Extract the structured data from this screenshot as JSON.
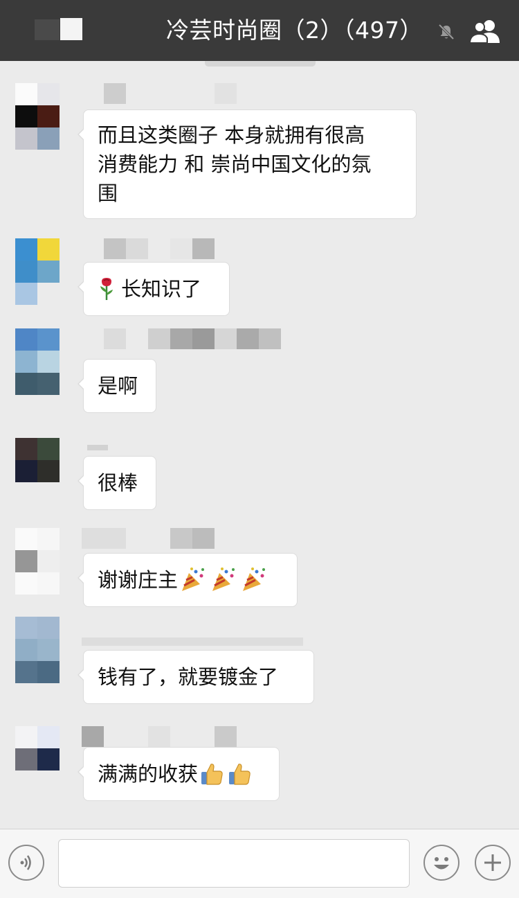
{
  "header": {
    "title": "冷芸时尚圈（2）（497）",
    "mute_icon": "bell-muted-icon",
    "members_icon": "group-members-icon"
  },
  "messages": [
    {
      "text": "而且这类圈子 本身就拥有很高\n消费能力 和 崇尚中国文化的氛\n围"
    },
    {
      "prefix_emoji": "rose",
      "text": "长知识了"
    },
    {
      "text": "是啊"
    },
    {
      "text": "很棒"
    },
    {
      "text": "谢谢庄主",
      "suffix_emoji": [
        "party-popper",
        "party-popper",
        "party-popper"
      ]
    },
    {
      "text": "钱有了，就要镀金了"
    },
    {
      "text": "满满的收获",
      "suffix_emoji": [
        "thumbs-up",
        "thumbs-up"
      ]
    }
  ],
  "input_bar": {
    "voice_icon": "voice-icon",
    "emoji_icon": "emoji-smile-icon",
    "plus_icon": "plus-icon",
    "input_value": ""
  },
  "colors": {
    "header_bg": "#3a3a3a",
    "chat_bg": "#ebebeb",
    "bubble_bg": "#ffffff"
  }
}
